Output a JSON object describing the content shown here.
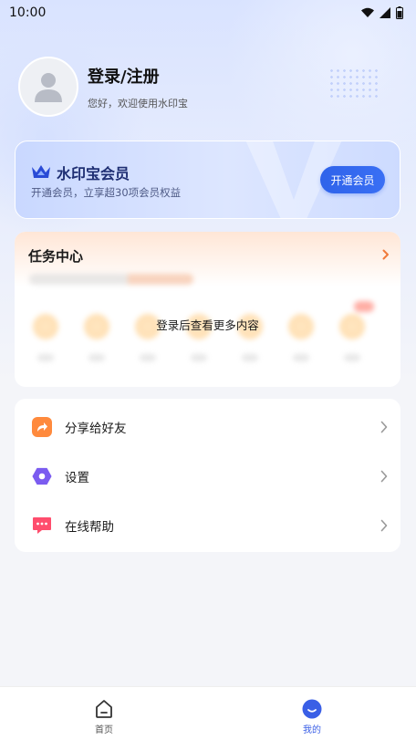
{
  "status_bar": {
    "time": "10:00",
    "icons": [
      "wifi-icon",
      "signal-icon",
      "battery-icon"
    ]
  },
  "profile": {
    "title": "登录/注册",
    "subtitle": "您好，欢迎使用水印宝"
  },
  "vip": {
    "title": "水印宝会员",
    "description": "开通会员，立享超30项会员权益",
    "button_label": "开通会员",
    "accent": "#2f63ea"
  },
  "task_center": {
    "title": "任务中心",
    "overlay_text": "登录后查看更多内容",
    "arrow_color": "#f07a3a"
  },
  "menu": {
    "items": [
      {
        "label": "分享给好友",
        "icon": "share-icon",
        "color": "#ff8a3d"
      },
      {
        "label": "设置",
        "icon": "settings-icon",
        "color": "#7b5cf0"
      },
      {
        "label": "在线帮助",
        "icon": "chat-help-icon",
        "color": "#ff4d6d"
      }
    ]
  },
  "bottom_nav": {
    "items": [
      {
        "label": "首页",
        "icon": "home-icon",
        "active": false
      },
      {
        "label": "我的",
        "icon": "profile-icon",
        "active": true
      }
    ],
    "active_color": "#3a5fe6",
    "inactive_color": "#555555"
  }
}
